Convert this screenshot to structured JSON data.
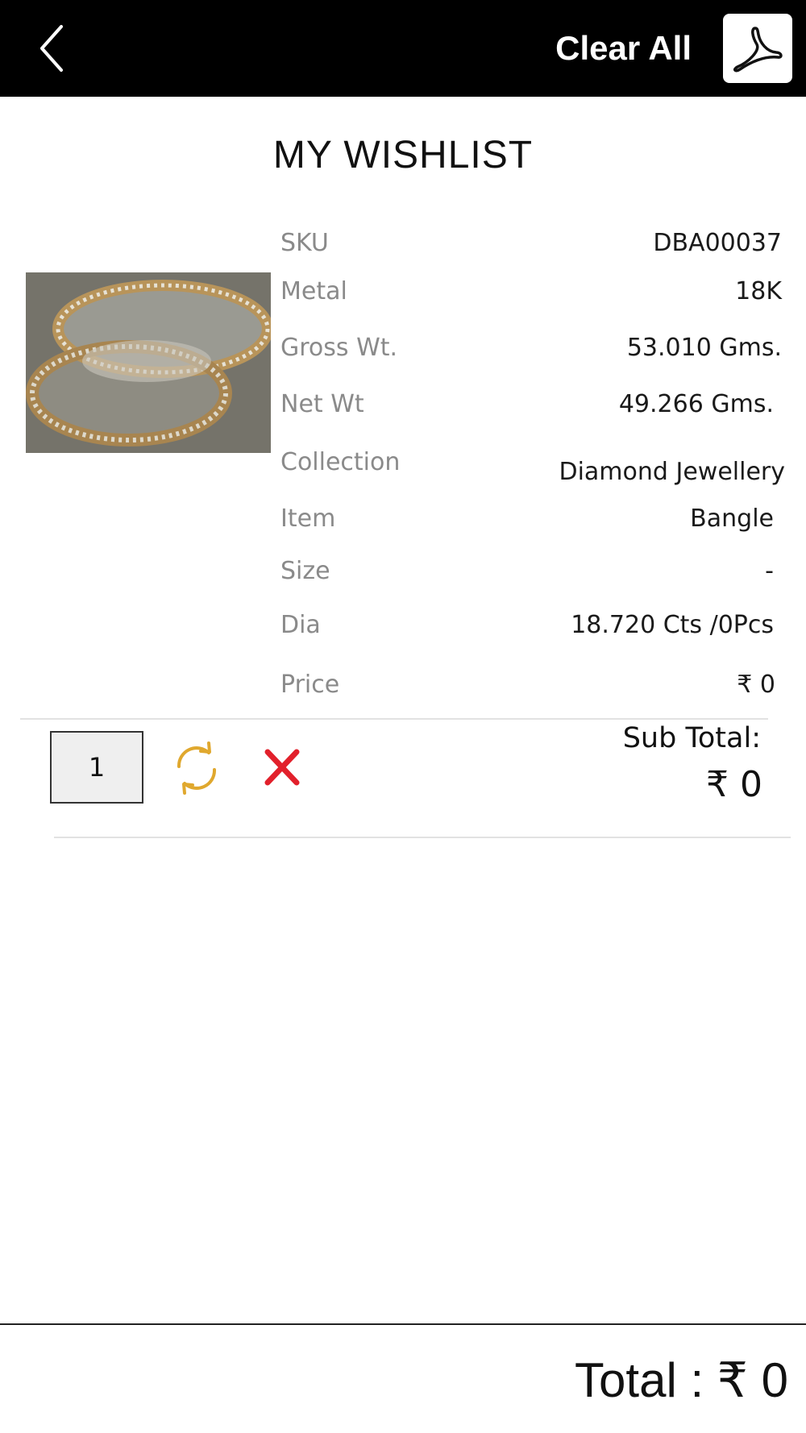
{
  "header": {
    "clear_all_label": "Clear All",
    "back_icon": "chevron-left-icon",
    "pdf_icon": "acrobat-pdf-icon"
  },
  "page": {
    "title": "MY WISHLIST"
  },
  "item": {
    "image_alt": "Gold and diamond bangles",
    "details": [
      {
        "label": "SKU",
        "value": "DBA00037"
      },
      {
        "label": "Metal",
        "value": "18K"
      },
      {
        "label": "Gross Wt.",
        "value": "53.010 Gms."
      },
      {
        "label": "Net Wt",
        "value": "49.266 Gms."
      },
      {
        "label": "Collection",
        "value": "Diamond Jewellery"
      },
      {
        "label": "Item",
        "value": "Bangle"
      },
      {
        "label": "Size",
        "value": "-"
      },
      {
        "label": "Dia",
        "value": "18.720 Cts /0Pcs"
      },
      {
        "label": "Price",
        "value": "₹ 0"
      }
    ],
    "quantity": "1",
    "subtotal_label": "Sub Total:",
    "subtotal_value": "₹ 0"
  },
  "footer": {
    "total_text": "Total : ₹ 0"
  },
  "colors": {
    "header_bg": "#000000",
    "refresh_icon": "#E0A82E",
    "remove_icon": "#E2202B",
    "label_gray": "#8A8A8A"
  }
}
